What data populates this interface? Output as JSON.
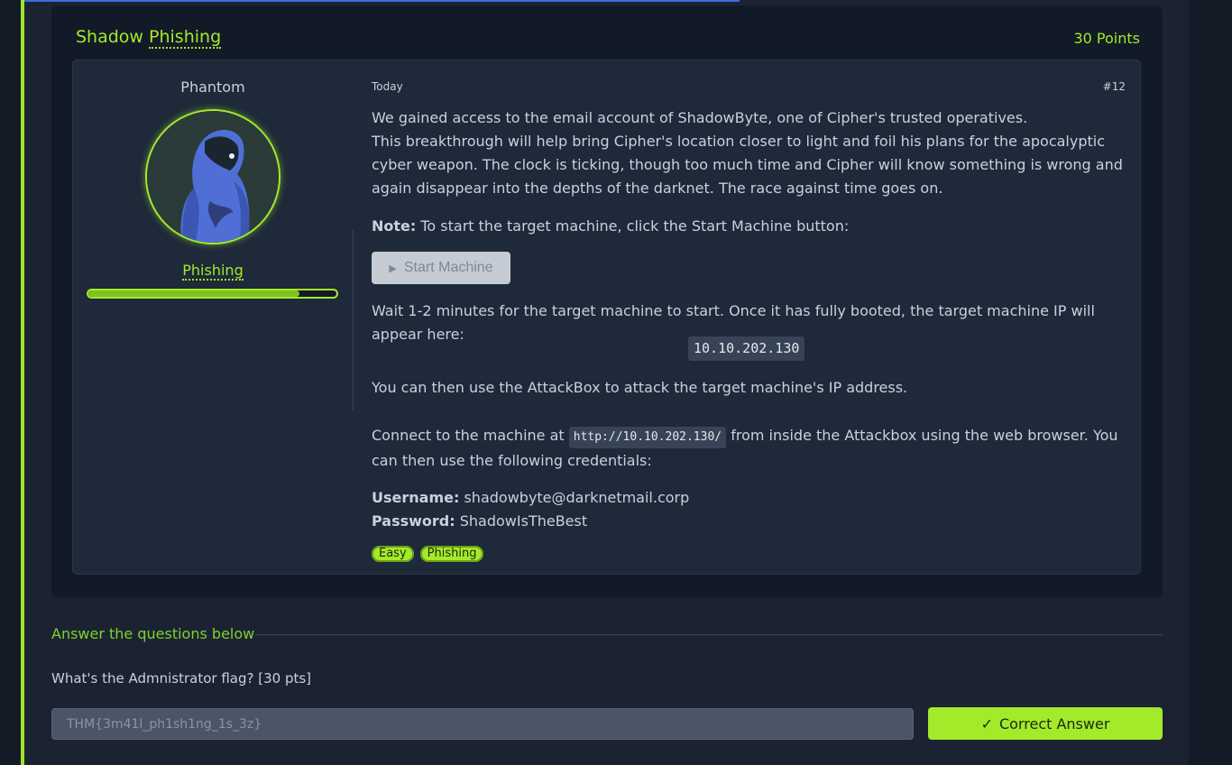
{
  "task": {
    "title_pre": "Shadow",
    "title_dotted": "Phishing",
    "points": "30 Points"
  },
  "post": {
    "author": "Phantom",
    "rank": "Phishing",
    "xp_fraction": 0.85,
    "date": "Today",
    "number": "#12",
    "para1_line1": "We gained access to the email account of ShadowByte, one of Cipher's trusted operatives.",
    "para1_rest": "This breakthrough will help bring Cipher's location closer to light and foil his plans for the apocalyptic cyber weapon. The clock is ticking, though too much time and Cipher will know something is wrong and again disappear into the depths of the darknet. The race against time goes on.",
    "note_label": "Note:",
    "note_text": "To start the target machine, click the Start Machine button:",
    "start_button": "Start Machine",
    "wait_text": "Wait 1-2 minutes for the target machine to start. Once it has fully booted, the target machine IP will appear here:",
    "ip": "10.10.202.130",
    "attackbox_text": "You can then use the AttackBox to attack the target machine's IP address.",
    "connect_pre": "Connect to the machine at",
    "connect_url": "http://10.10.202.130/",
    "connect_post": "from inside the Attackbox using the web browser. You can then use the following credentials:",
    "username_label": "Username:",
    "username": "shadowbyte@darknetmail.corp",
    "password_label": "Password:",
    "password": "ShadowIsTheBest",
    "tags": [
      "Easy",
      "Phishing"
    ]
  },
  "answers": {
    "heading": "Answer the questions below",
    "question": "What's the Admnistrator flag? [30 pts]",
    "answer_value": "THM{3m41l_ph1sh1ng_1s_3z}",
    "submit_label": "Correct Answer"
  },
  "colors": {
    "accent_green": "#a3ea2a",
    "card_bg": "#121a28",
    "page_bg": "#1b2332"
  }
}
